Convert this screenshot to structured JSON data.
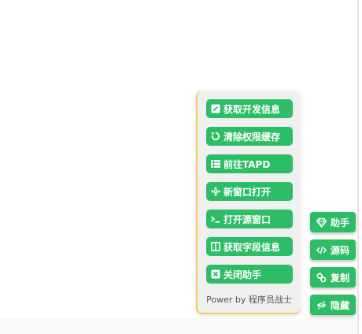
{
  "helper_panel": {
    "buttons": [
      {
        "label": "获取开发信息",
        "icon": "edit-square-icon"
      },
      {
        "label": "清除权限缓存",
        "icon": "refresh-icon"
      },
      {
        "label": "前往TAPD",
        "icon": "list-icon"
      },
      {
        "label": "新窗口打开",
        "icon": "move-arrows-icon"
      },
      {
        "label": "打开源窗口",
        "icon": "terminal-icon"
      },
      {
        "label": "获取字段信息",
        "icon": "columns-icon"
      },
      {
        "label": "关闭助手",
        "icon": "close-square-icon"
      }
    ],
    "footer": "Power by 程序员战士"
  },
  "side_buttons": [
    {
      "label": "助手",
      "icon": "diamond-icon"
    },
    {
      "label": "源码",
      "icon": "code-icon"
    },
    {
      "label": "复制",
      "icon": "link-icon"
    },
    {
      "label": "隐藏",
      "icon": "eye-slash-icon"
    }
  ],
  "colors": {
    "button_green": "#2ebd67",
    "panel_background": "#f0f0f0",
    "panel_accent": "#f6c659"
  }
}
